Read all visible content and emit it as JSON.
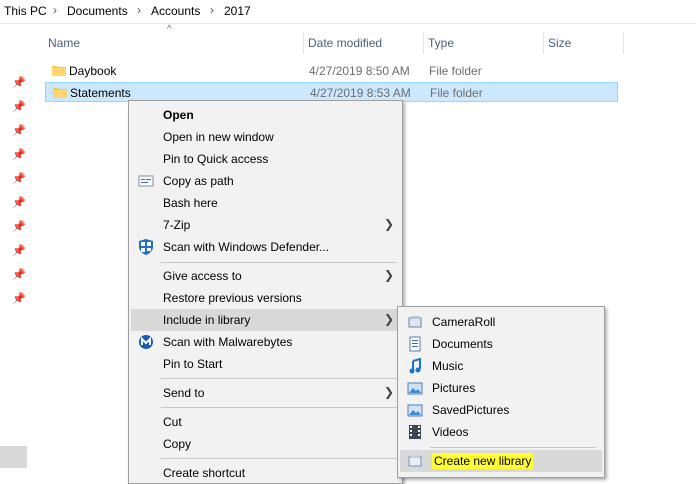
{
  "breadcrumb": {
    "items": [
      "This PC",
      "Documents",
      "Accounts",
      "2017"
    ],
    "separator": "›"
  },
  "columns": {
    "name": "Name",
    "date_modified": "Date modified",
    "type": "Type",
    "size": "Size",
    "sort_icon": "sort-ascending-icon"
  },
  "files": [
    {
      "name": "Daybook",
      "date": "4/27/2019 8:50 AM",
      "type": "File folder"
    },
    {
      "name": "Statements",
      "date": "4/27/2019 8:53 AM",
      "type": "File folder"
    }
  ],
  "context_menu": {
    "open": "Open",
    "open_new_window": "Open in new window",
    "pin_quick_access": "Pin to Quick access",
    "copy_as_path": "Copy as path",
    "bash_here": "Bash here",
    "seven_zip": "7-Zip",
    "scan_defender": "Scan with Windows Defender...",
    "give_access": "Give access to",
    "restore_versions": "Restore previous versions",
    "include_library": "Include in library",
    "scan_malwarebytes": "Scan with Malwarebytes",
    "pin_start": "Pin to Start",
    "send_to": "Send to",
    "cut": "Cut",
    "copy": "Copy",
    "create_shortcut": "Create shortcut"
  },
  "library_submenu": {
    "camera_roll": "CameraRoll",
    "documents": "Documents",
    "music": "Music",
    "pictures": "Pictures",
    "saved_pictures": "SavedPictures",
    "videos": "Videos",
    "create_new_library": "Create new library"
  },
  "colors": {
    "selection": "#cce8ff",
    "highlight": "#ffff33",
    "menu_bg": "#f2f2f2",
    "folder": "#f3c94f"
  }
}
